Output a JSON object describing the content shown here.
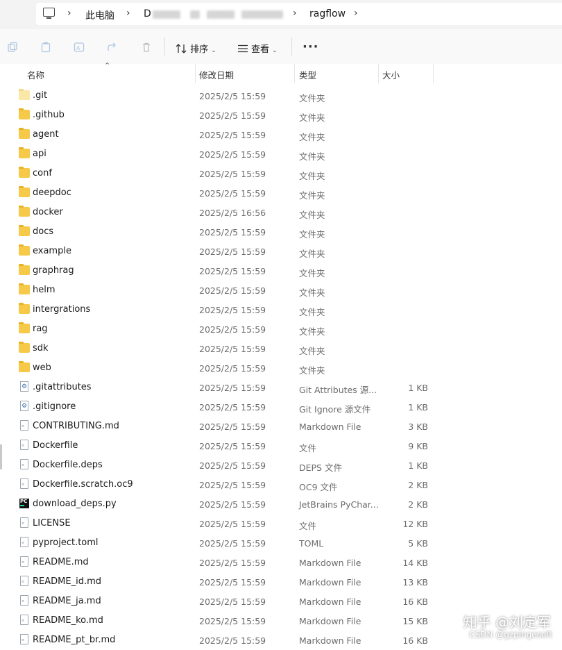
{
  "address": {
    "crumbs": [
      "此电脑",
      "D",
      "ragflow"
    ]
  },
  "toolbar": {
    "sort_label": "排序",
    "view_label": "查看",
    "more_label": "···"
  },
  "columns": {
    "name": "名称",
    "date": "修改日期",
    "type": "类型",
    "size": "大小"
  },
  "rows": [
    {
      "name": ".git",
      "date": "2025/2/5 15:59",
      "type": "文件夹",
      "size": "",
      "icon": "folder-faint"
    },
    {
      "name": ".github",
      "date": "2025/2/5 15:59",
      "type": "文件夹",
      "size": "",
      "icon": "folder"
    },
    {
      "name": "agent",
      "date": "2025/2/5 15:59",
      "type": "文件夹",
      "size": "",
      "icon": "folder"
    },
    {
      "name": "api",
      "date": "2025/2/5 15:59",
      "type": "文件夹",
      "size": "",
      "icon": "folder"
    },
    {
      "name": "conf",
      "date": "2025/2/5 15:59",
      "type": "文件夹",
      "size": "",
      "icon": "folder"
    },
    {
      "name": "deepdoc",
      "date": "2025/2/5 15:59",
      "type": "文件夹",
      "size": "",
      "icon": "folder"
    },
    {
      "name": "docker",
      "date": "2025/2/5 16:56",
      "type": "文件夹",
      "size": "",
      "icon": "folder"
    },
    {
      "name": "docs",
      "date": "2025/2/5 15:59",
      "type": "文件夹",
      "size": "",
      "icon": "folder"
    },
    {
      "name": "example",
      "date": "2025/2/5 15:59",
      "type": "文件夹",
      "size": "",
      "icon": "folder"
    },
    {
      "name": "graphrag",
      "date": "2025/2/5 15:59",
      "type": "文件夹",
      "size": "",
      "icon": "folder"
    },
    {
      "name": "helm",
      "date": "2025/2/5 15:59",
      "type": "文件夹",
      "size": "",
      "icon": "folder"
    },
    {
      "name": "intergrations",
      "date": "2025/2/5 15:59",
      "type": "文件夹",
      "size": "",
      "icon": "folder"
    },
    {
      "name": "rag",
      "date": "2025/2/5 15:59",
      "type": "文件夹",
      "size": "",
      "icon": "folder"
    },
    {
      "name": "sdk",
      "date": "2025/2/5 15:59",
      "type": "文件夹",
      "size": "",
      "icon": "folder"
    },
    {
      "name": "web",
      "date": "2025/2/5 15:59",
      "type": "文件夹",
      "size": "",
      "icon": "folder"
    },
    {
      "name": ".gitattributes",
      "date": "2025/2/5 15:59",
      "type": "Git Attributes 源...",
      "size": "1 KB",
      "icon": "gear-file"
    },
    {
      "name": ".gitignore",
      "date": "2025/2/5 15:59",
      "type": "Git Ignore 源文件",
      "size": "1 KB",
      "icon": "gear-file"
    },
    {
      "name": "CONTRIBUTING.md",
      "date": "2025/2/5 15:59",
      "type": "Markdown File",
      "size": "3 KB",
      "icon": "file"
    },
    {
      "name": "Dockerfile",
      "date": "2025/2/5 15:59",
      "type": "文件",
      "size": "9 KB",
      "icon": "file"
    },
    {
      "name": "Dockerfile.deps",
      "date": "2025/2/5 15:59",
      "type": "DEPS 文件",
      "size": "1 KB",
      "icon": "file"
    },
    {
      "name": "Dockerfile.scratch.oc9",
      "date": "2025/2/5 15:59",
      "type": "OC9 文件",
      "size": "2 KB",
      "icon": "file"
    },
    {
      "name": "download_deps.py",
      "date": "2025/2/5 15:59",
      "type": "JetBrains PyChar...",
      "size": "2 KB",
      "icon": "py-file"
    },
    {
      "name": "LICENSE",
      "date": "2025/2/5 15:59",
      "type": "文件",
      "size": "12 KB",
      "icon": "file"
    },
    {
      "name": "pyproject.toml",
      "date": "2025/2/5 15:59",
      "type": "TOML",
      "size": "5 KB",
      "icon": "file"
    },
    {
      "name": "README.md",
      "date": "2025/2/5 15:59",
      "type": "Markdown File",
      "size": "14 KB",
      "icon": "file"
    },
    {
      "name": "README_id.md",
      "date": "2025/2/5 15:59",
      "type": "Markdown File",
      "size": "13 KB",
      "icon": "file"
    },
    {
      "name": "README_ja.md",
      "date": "2025/2/5 15:59",
      "type": "Markdown File",
      "size": "16 KB",
      "icon": "file"
    },
    {
      "name": "README_ko.md",
      "date": "2025/2/5 15:59",
      "type": "Markdown File",
      "size": "15 KB",
      "icon": "file"
    },
    {
      "name": "README_pt_br.md",
      "date": "2025/2/5 15:59",
      "type": "Markdown File",
      "size": "16 KB",
      "icon": "file"
    }
  ],
  "watermark": {
    "main": "知乎 @刘定军",
    "sub": "CSDN @gzpingesoft"
  }
}
